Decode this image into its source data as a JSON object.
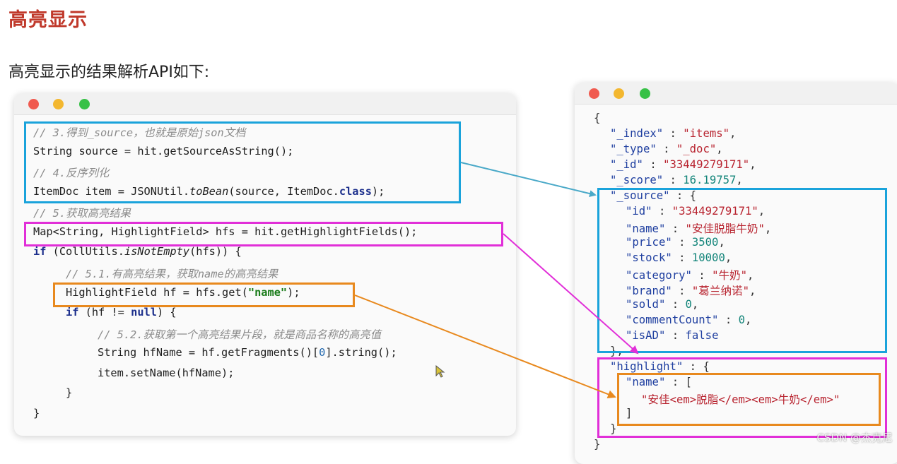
{
  "heading": "高亮显示",
  "subtitle": "高亮显示的结果解析API如下:",
  "code": {
    "c3": "// 3.得到_source，也就是原始json文档",
    "l2_a": "String source = hit.getSourceAsString();",
    "c4": "// 4.反序列化",
    "l4_a": "ItemDoc item = JSONUtil.",
    "l4_b": "toBean",
    "l4_c": "(source, ItemDoc.",
    "l4_d": "class",
    "l4_e": ");",
    "c5": "// 5.获取高亮结果",
    "l6": "Map<String, HighlightField> hfs = hit.getHighlightFields();",
    "l7_kw": "if",
    "l7_a": " (CollUtils.",
    "l7_b": "isNotEmpty",
    "l7_c": "(hfs)) {",
    "c51": "// 5.1.有高亮结果，获取name的高亮结果",
    "l9_a": "HighlightField hf = hfs.get(",
    "l9_str": "\"name\"",
    "l9_b": ");",
    "l10_kw": "if",
    "l10_a": " (hf != ",
    "l10_null": "null",
    "l10_b": ") {",
    "c52": "// 5.2.获取第一个高亮结果片段，就是商品名称的高亮值",
    "l12_a": "String hfName = hf.getFragments()[",
    "l12_num": "0",
    "l12_b": "].string();",
    "l13": "item.setName(hfName);",
    "l14": "}",
    "l15": "}"
  },
  "json": {
    "open": "{",
    "index_k": "\"_index\"",
    "index_v": "\"items\"",
    "type_k": "\"_type\"",
    "type_v": "\"_doc\"",
    "id_k": "\"_id\"",
    "id_v": "\"33449279171\"",
    "score_k": "\"_score\"",
    "score_v": "16.19757",
    "source_k": "\"_source\"",
    "s_id_k": "\"id\"",
    "s_id_v": "\"33449279171\"",
    "s_name_k": "\"name\"",
    "s_name_v": "\"安佳脱脂牛奶\"",
    "s_price_k": "\"price\"",
    "s_price_v": "3500",
    "s_stock_k": "\"stock\"",
    "s_stock_v": "10000",
    "s_cat_k": "\"category\"",
    "s_cat_v": "\"牛奶\"",
    "s_brand_k": "\"brand\"",
    "s_brand_v": "\"葛兰纳诺\"",
    "s_sold_k": "\"sold\"",
    "s_sold_v": "0",
    "s_cc_k": "\"commentCount\"",
    "s_cc_v": "0",
    "s_ad_k": "\"isAD\"",
    "s_ad_v": "false",
    "source_close": "},",
    "hl_k": "\"highlight\"",
    "hl_name_k": "\"name\"",
    "hl_val": "\"安佳<em>脱脂</em><em>牛奶</em>\"",
    "hl_arr_close": "]",
    "hl_close": "}",
    "close": "}"
  },
  "watermark": "CSDN @杰克尼",
  "colors": {
    "blue_box": "#1aa3db",
    "magenta_box": "#e12fd8",
    "orange_box": "#e8891e",
    "blue_arrow": "#4aa9c8",
    "magenta_arrow": "#e12fd8",
    "orange_arrow": "#e8891e"
  }
}
